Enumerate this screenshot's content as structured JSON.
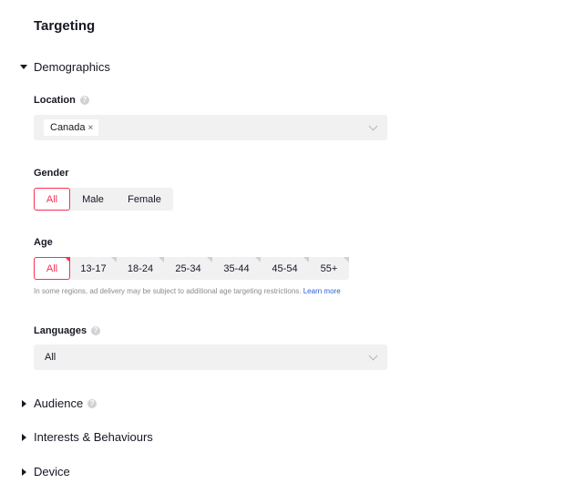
{
  "title": "Targeting",
  "demographics": {
    "label": "Demographics",
    "expanded": true,
    "location": {
      "label": "Location",
      "help_icon": "question-circle-icon",
      "selected_tags": [
        {
          "label": "Canada",
          "remove_icon": "×"
        }
      ],
      "dropdown_icon": "chevron-down-icon"
    },
    "gender": {
      "label": "Gender",
      "options": [
        "All",
        "Male",
        "Female"
      ],
      "selected": "All"
    },
    "age": {
      "label": "Age",
      "options": [
        "All",
        "13-17",
        "18-24",
        "25-34",
        "35-44",
        "45-54",
        "55+"
      ],
      "selected": "All",
      "note": "In some regions, ad delivery may be subject to additional age targeting restrictions.",
      "learn_more": "Learn more"
    },
    "languages": {
      "label": "Languages",
      "help_icon": "question-circle-icon",
      "value": "All",
      "dropdown_icon": "chevron-down-icon"
    }
  },
  "sections": [
    {
      "label": "Audience",
      "expanded": false,
      "has_help": true
    },
    {
      "label": "Interests & Behaviours",
      "expanded": false,
      "has_help": false
    },
    {
      "label": "Device",
      "expanded": false,
      "has_help": false
    }
  ],
  "colors": {
    "accent": "#fe2c55",
    "link": "#2b5dd9",
    "field_bg": "#f1f1f2"
  }
}
